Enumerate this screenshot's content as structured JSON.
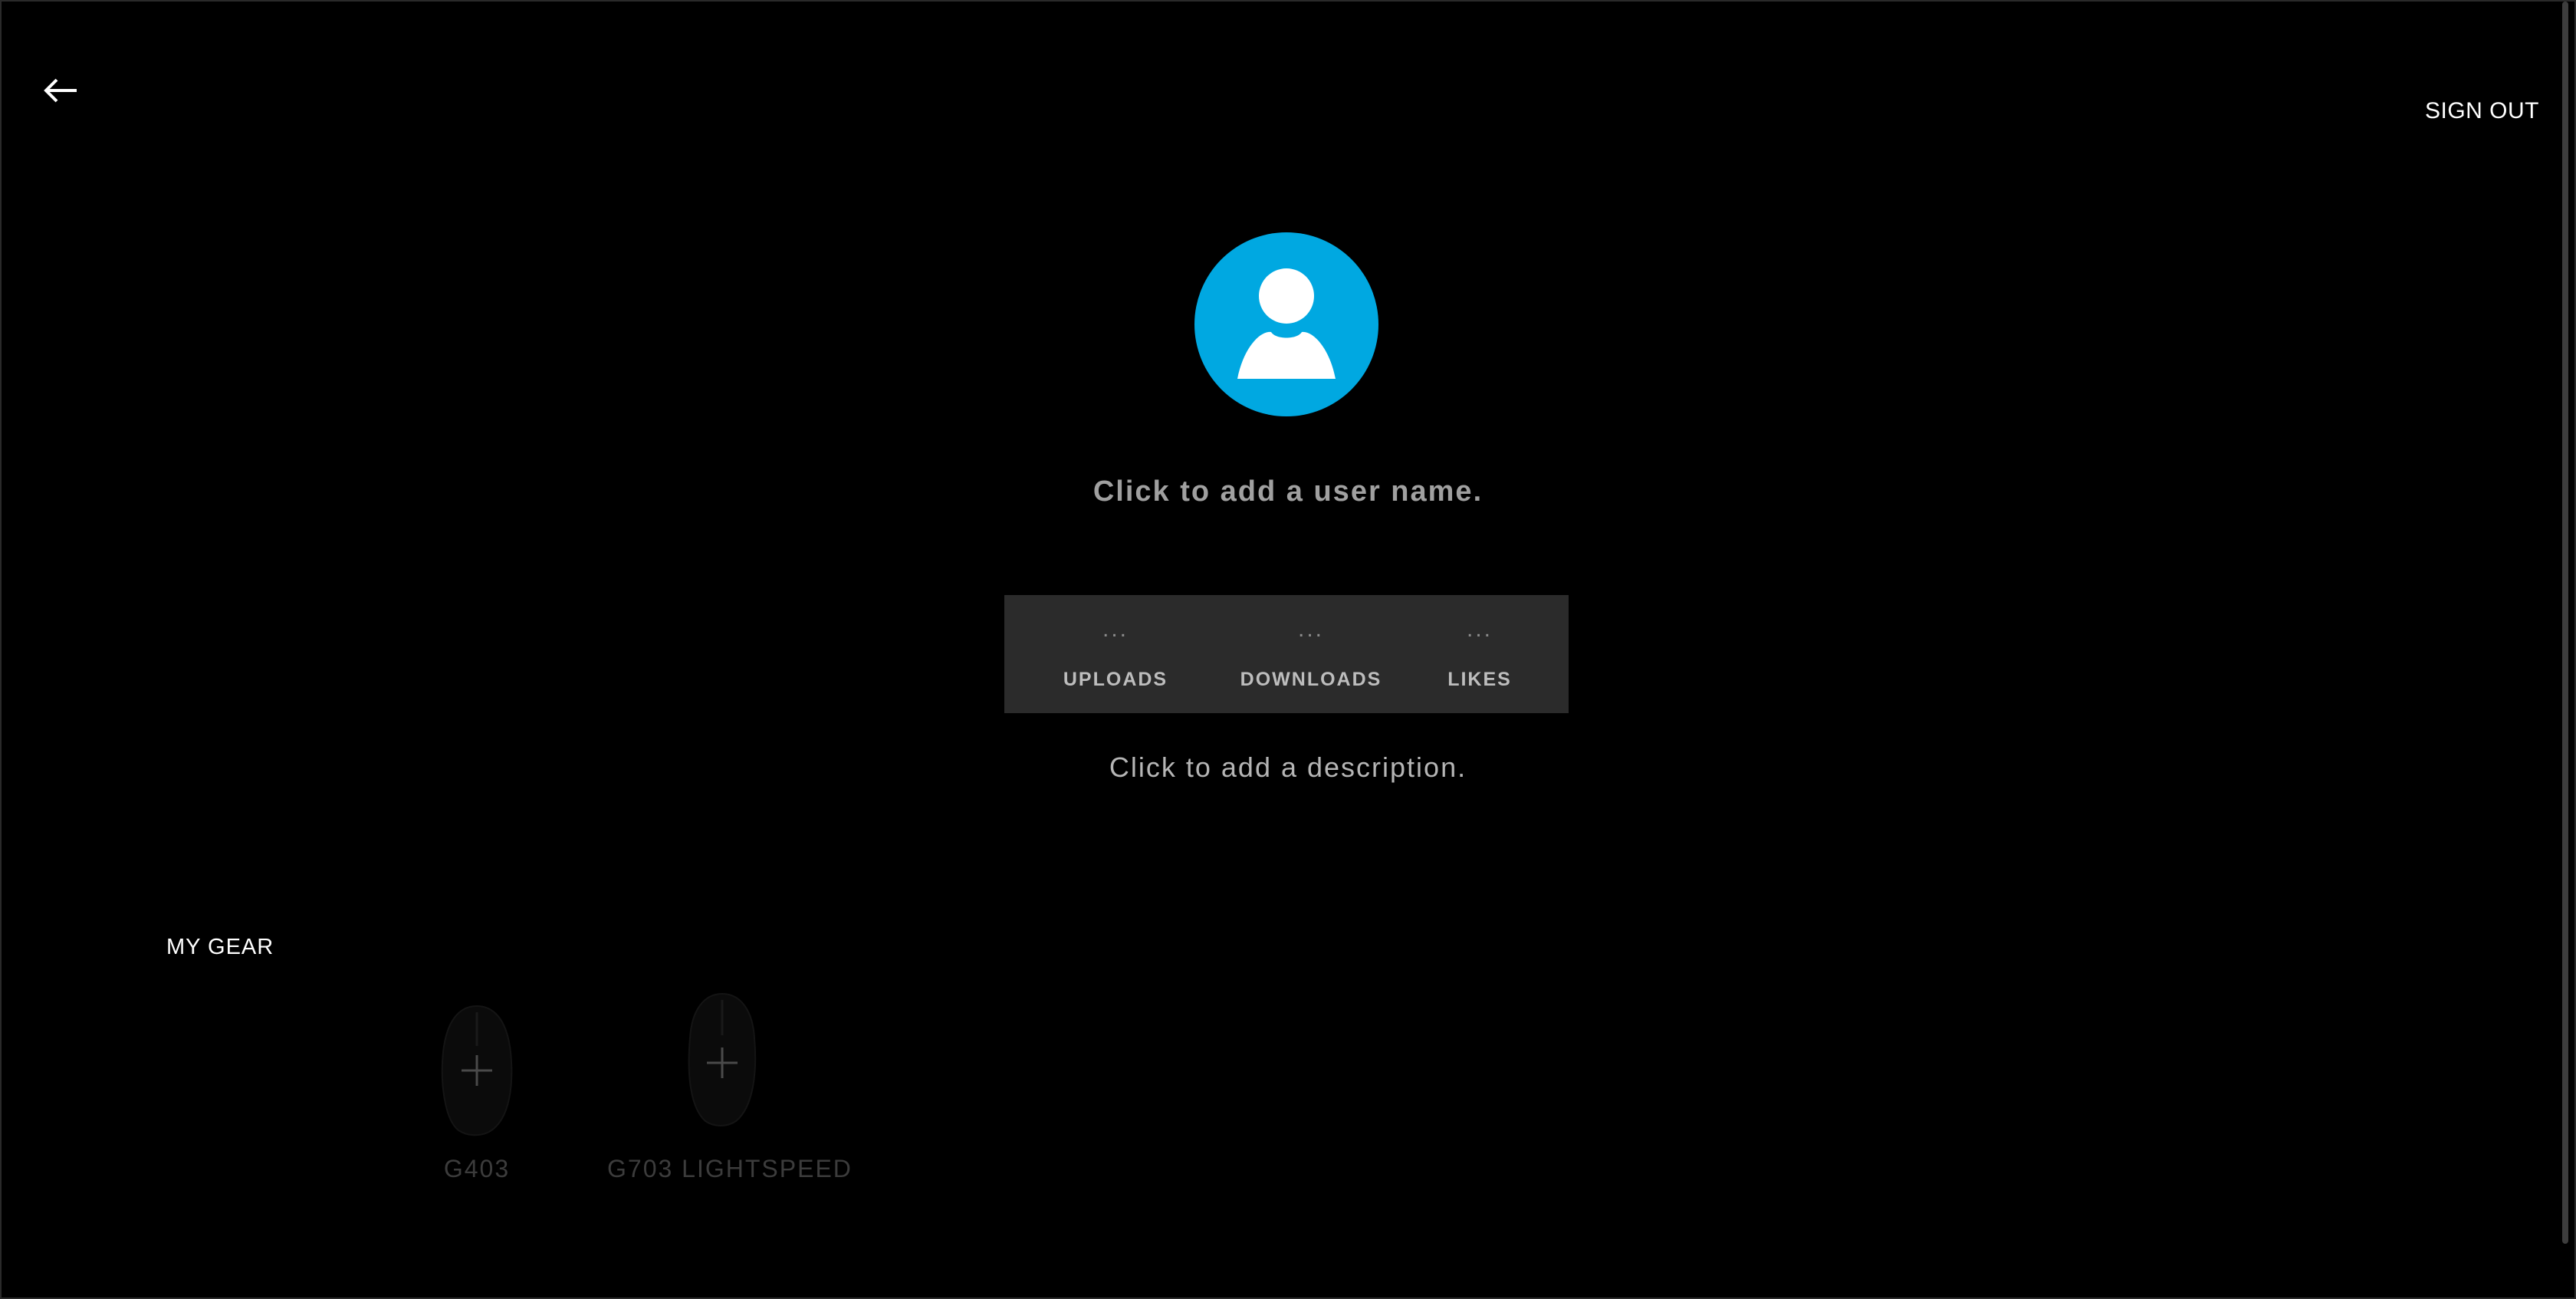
{
  "header": {
    "back_icon": "arrow-left-icon",
    "sign_out_label": "SIGN OUT"
  },
  "profile": {
    "avatar_icon": "user-avatar-icon",
    "avatar_color": "#00a8e1",
    "user_name_placeholder": "Click to add a user name.",
    "description_placeholder": "Click to add a description."
  },
  "stats": [
    {
      "value": "...",
      "label": "UPLOADS"
    },
    {
      "value": "...",
      "label": "DOWNLOADS"
    },
    {
      "value": "...",
      "label": "LIKES"
    }
  ],
  "gear": {
    "title": "MY GEAR",
    "items": [
      {
        "name": "G403",
        "icon": "mouse-icon"
      },
      {
        "name": "G703 LIGHTSPEED",
        "icon": "mouse-icon"
      }
    ]
  }
}
